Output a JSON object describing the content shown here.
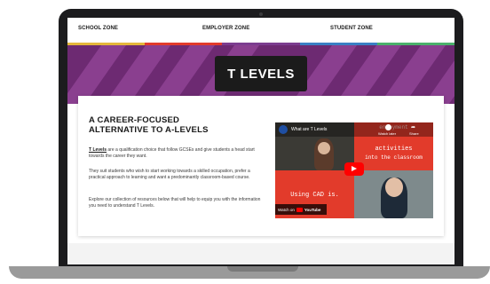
{
  "nav": {
    "items": [
      "SCHOOL ZONE",
      "EMPLOYER ZONE",
      "STUDENT ZONE"
    ]
  },
  "hero": {
    "title": "T LEVELS"
  },
  "content": {
    "heading_line1": "A CAREER-FOCUSED",
    "heading_line2": "ALTERNATIVE TO A-LEVELS",
    "p1_link": "T Levels",
    "p1_rest": " are a qualification choice that follow GCSEs and give students a head start towards the career they want.",
    "p2": "They suit students who wish to start working towards a skilled occupation, prefer a practical approach to learning and want a predominantly classroom-based course.",
    "p3": "Explore our collection of resources below that will help to equip you with the information you need to understand T Levels."
  },
  "video": {
    "title": "What are T Levels",
    "watch_later": "Watch later",
    "share": "Share",
    "top_right_text": "enjoyment",
    "activities_line1": "activities",
    "activities_line2": "into the classroom",
    "using_cad": "Using CAD is.",
    "watch_on": "Watch on",
    "youtube": "YouTube"
  },
  "colors": {
    "hero_bg": "#6d2a72",
    "accent_red": "#e23b2b",
    "stripe": [
      "#e4b73b",
      "#e23b2b",
      "#7c3d8f",
      "#3a7fc4",
      "#4bb06b"
    ]
  }
}
